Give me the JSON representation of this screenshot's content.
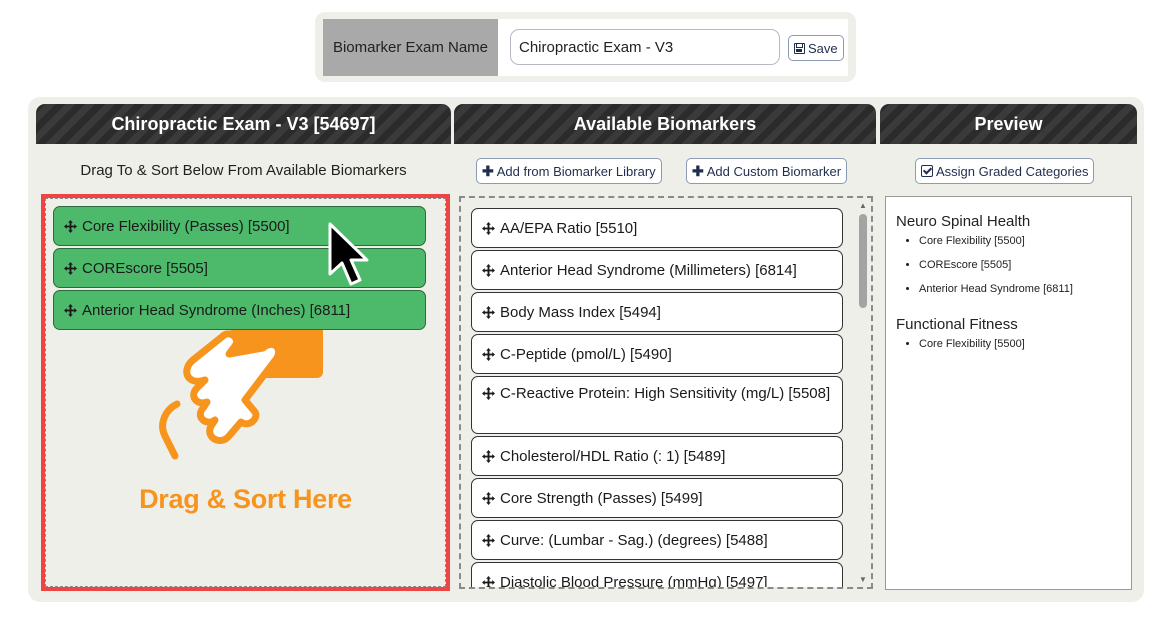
{
  "exam_name_bar": {
    "label": "Biomarker Exam Name",
    "name_value": "Chiropractic Exam - V3",
    "save_label": "Save"
  },
  "columns": {
    "exam_header": "Chiropractic Exam - V3 [54697]",
    "available_header": "Available Biomarkers",
    "preview_header": "Preview"
  },
  "exam_column": {
    "subtitle": "Drag To & Sort Below From Available Biomarkers",
    "drop_hint": "Drag & Sort Here",
    "selected_items": [
      "Core Flexibility (Passes) [5500]",
      "COREscore [5505]",
      "Anterior Head Syndrome (Inches) [6811]"
    ],
    "accent_color": "#4cb96b",
    "highlight_border": "#ef4444",
    "illustration_color": "#f7941d"
  },
  "available_column": {
    "add_library_label": "Add from Biomarker Library",
    "add_custom_label": "Add Custom Biomarker",
    "items": [
      "AA/EPA Ratio [5510]",
      "Anterior Head Syndrome (Millimeters) [6814]",
      "Body Mass Index [5494]",
      "C-Peptide (pmol/L) [5490]",
      "C-Reactive Protein: High Sensitivity (mg/L) [5508]",
      "Cholesterol/HDL Ratio (: 1) [5489]",
      "Core Strength (Passes) [5499]",
      "Curve: (Lumbar - Sag.) (degrees) [5488]",
      "Diastolic Blood Pressure (mmHg) [5497]"
    ]
  },
  "preview_column": {
    "assign_label": "Assign Graded Categories",
    "groups": [
      {
        "title": "Neuro Spinal Health",
        "items": [
          "Core Flexibility [5500]",
          "COREscore [5505]",
          "Anterior Head Syndrome [6811]"
        ]
      },
      {
        "title": "Functional Fitness",
        "items": [
          "Core Flexibility [5500]"
        ]
      }
    ]
  },
  "icons": {
    "move": "move-arrows-icon",
    "save": "floppy-disk-icon",
    "add": "plus-icon",
    "assign": "checkbox-icon",
    "cursor": "mouse-pointer-icon"
  }
}
